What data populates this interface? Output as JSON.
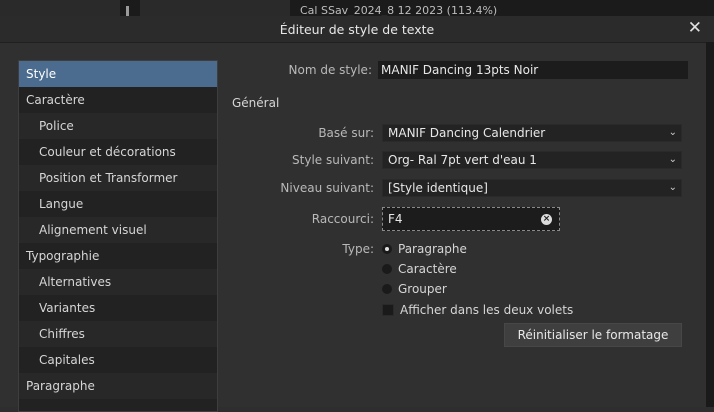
{
  "background": {
    "doc_tab_text": "Cal SSav_2024_8 12 2023 (113.4%)"
  },
  "dialog": {
    "title": "Éditeur de style de texte",
    "close_glyph": "✕"
  },
  "sidebar": {
    "items": [
      {
        "label": "Style",
        "level": "top",
        "selected": true
      },
      {
        "label": "Caractère",
        "level": "top"
      },
      {
        "label": "Police",
        "level": "sub"
      },
      {
        "label": "Couleur et décorations",
        "level": "sub"
      },
      {
        "label": "Position et Transformer",
        "level": "sub"
      },
      {
        "label": "Langue",
        "level": "sub"
      },
      {
        "label": "Alignement visuel",
        "level": "sub"
      },
      {
        "label": "Typographie",
        "level": "top"
      },
      {
        "label": "Alternatives",
        "level": "sub"
      },
      {
        "label": "Variantes",
        "level": "sub"
      },
      {
        "label": "Chiffres",
        "level": "sub"
      },
      {
        "label": "Capitales",
        "level": "sub"
      },
      {
        "label": "Paragraphe",
        "level": "top"
      }
    ]
  },
  "form": {
    "style_name_label": "Nom de style:",
    "style_name_value": "MANIF Dancing 13pts Noir",
    "section_general": "Général",
    "based_on_label": "Basé sur:",
    "based_on_value": "MANIF Dancing Calendrier",
    "next_style_label": "Style suivant:",
    "next_style_value": "Org- Ral 7pt vert d'eau 1",
    "next_level_label": "Niveau suivant:",
    "next_level_value": "[Style identique]",
    "shortcut_label": "Raccourci:",
    "shortcut_value": "F4",
    "type_label": "Type:",
    "type_options": [
      "Paragraphe",
      "Caractère",
      "Grouper"
    ],
    "type_selected": "Paragraphe",
    "show_both_panels_label": "Afficher dans les deux volets",
    "show_both_panels_checked": false,
    "reset_button_label": "Réinitialiser le formatage"
  },
  "icons": {
    "chevron": "⌄",
    "clear": "×"
  },
  "colors": {
    "selection": "#4b6b8f",
    "dialog_bg": "#303030",
    "sidebar_bg": "#222222"
  }
}
